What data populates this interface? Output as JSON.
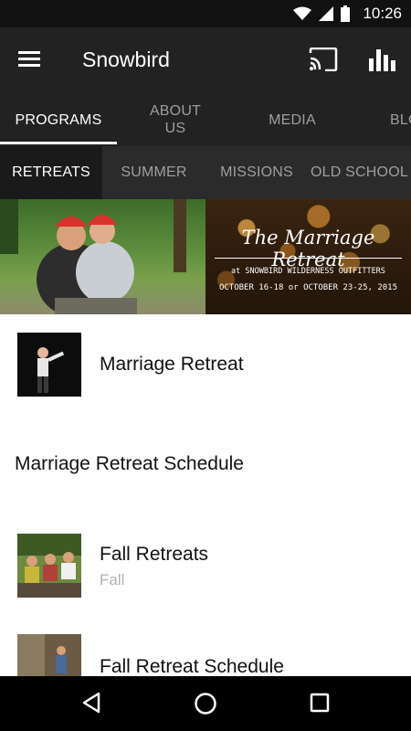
{
  "status_bar": {
    "time": "10:26"
  },
  "app_bar": {
    "title": "Snowbird"
  },
  "main_tabs": [
    {
      "label": "PROGRAMS",
      "active": true
    },
    {
      "label": "ABOUT\nUS",
      "active": false
    },
    {
      "label": "MEDIA",
      "active": false
    },
    {
      "label": "BLO",
      "active": false
    }
  ],
  "sub_tabs": [
    {
      "label": "RETREATS",
      "active": true
    },
    {
      "label": "SUMMER",
      "active": false
    },
    {
      "label": "MISSIONS",
      "active": false
    },
    {
      "label": "OLD SCHOOL",
      "active": false
    }
  ],
  "banner": {
    "title": "The Marriage Retreat",
    "subtitle": "at SNOWBIRD WILDERNESS OUTFITTERS",
    "dates": "OCTOBER 16-18 or OCTOBER 23-25, 2015"
  },
  "list": [
    {
      "title": "Marriage Retreat",
      "subtitle": "",
      "has_thumb": true
    },
    {
      "title": "Marriage Retreat Schedule",
      "subtitle": "",
      "has_thumb": false
    },
    {
      "title": "Fall Retreats",
      "subtitle": "Fall",
      "has_thumb": true
    },
    {
      "title": "Fall Retreat Schedule",
      "subtitle": "",
      "has_thumb": true
    }
  ],
  "icons": {
    "menu": "hamburger-icon",
    "cast": "cast-icon",
    "stats": "bar-chart-icon",
    "back": "back-triangle-icon",
    "home": "home-circle-icon",
    "recents": "recents-square-icon"
  },
  "colors": {
    "app_bar": "#222222",
    "sub_tabs": "#2b2b2b",
    "status_bar": "#111111",
    "nav_bar": "#000000"
  }
}
